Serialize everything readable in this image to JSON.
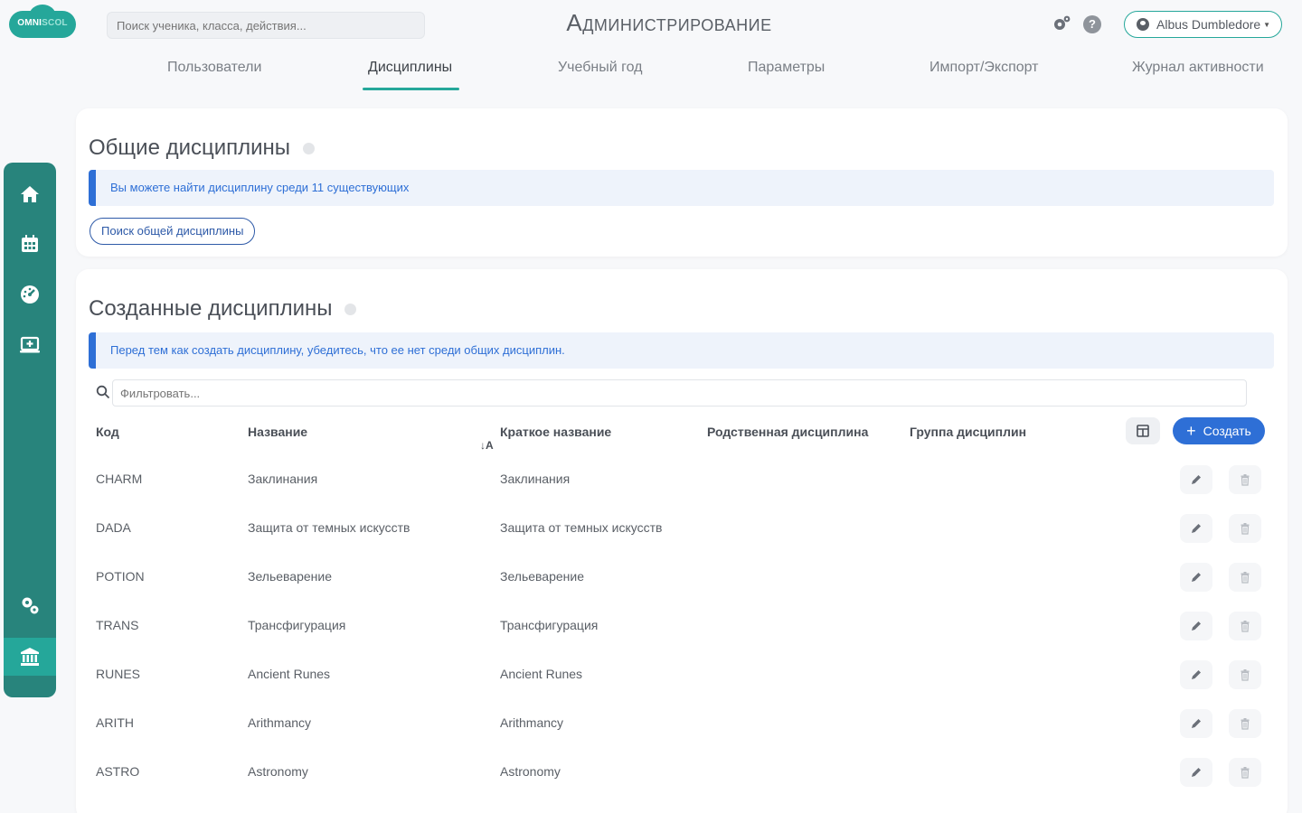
{
  "app": {
    "logo_main": "OMNI",
    "logo_light": "SCOL",
    "search_placeholder": "Поиск ученика, класса, действия...",
    "title": "Администрирование",
    "user_name": "Albus Dumbledore"
  },
  "tabs": [
    {
      "label": "Пользователи"
    },
    {
      "label": "Дисциплины"
    },
    {
      "label": "Учебный год"
    },
    {
      "label": "Параметры"
    },
    {
      "label": "Импорт/Экспорт"
    },
    {
      "label": "Журнал активности"
    }
  ],
  "sidebar": {
    "items": [
      "home-icon",
      "calendar-icon",
      "dashboard-icon",
      "screen-add-icon",
      "cogs-icon",
      "institution-icon"
    ],
    "active": "institution-icon"
  },
  "common": {
    "title": "Общие дисциплины",
    "info": "Вы можете найти дисциплину среди 11 существующих",
    "search_button": "Поиск общей дисциплины"
  },
  "created": {
    "title": "Созданные дисциплины",
    "info": "Перед тем как создать дисциплину, убедитесь, что ее нет среди общих дисциплин.",
    "filter_placeholder": "Фильтровать...",
    "create_label": "Создать",
    "columns": {
      "code": "Код",
      "name": "Название",
      "short": "Краткое название",
      "related": "Родственная дисциплина",
      "group": "Группа дисциплин"
    },
    "rows": [
      {
        "code": "CHARM",
        "name": "Заклинания",
        "short": "Заклинания"
      },
      {
        "code": "DADA",
        "name": "Защита от темных искусств",
        "short": "Защита от темных искусств"
      },
      {
        "code": "POTION",
        "name": "Зельеварение",
        "short": "Зельеварение"
      },
      {
        "code": "TRANS",
        "name": "Трансфигурация",
        "short": "Трансфигурация"
      },
      {
        "code": "RUNES",
        "name": "Ancient Runes",
        "short": "Ancient Runes"
      },
      {
        "code": "ARITH",
        "name": "Arithmancy",
        "short": "Arithmancy"
      },
      {
        "code": "ASTRO",
        "name": "Astronomy",
        "short": "Astronomy"
      }
    ]
  },
  "colors": {
    "brand": "#25a79a",
    "sidebar": "#28847c",
    "primary": "#2e6fd6"
  }
}
